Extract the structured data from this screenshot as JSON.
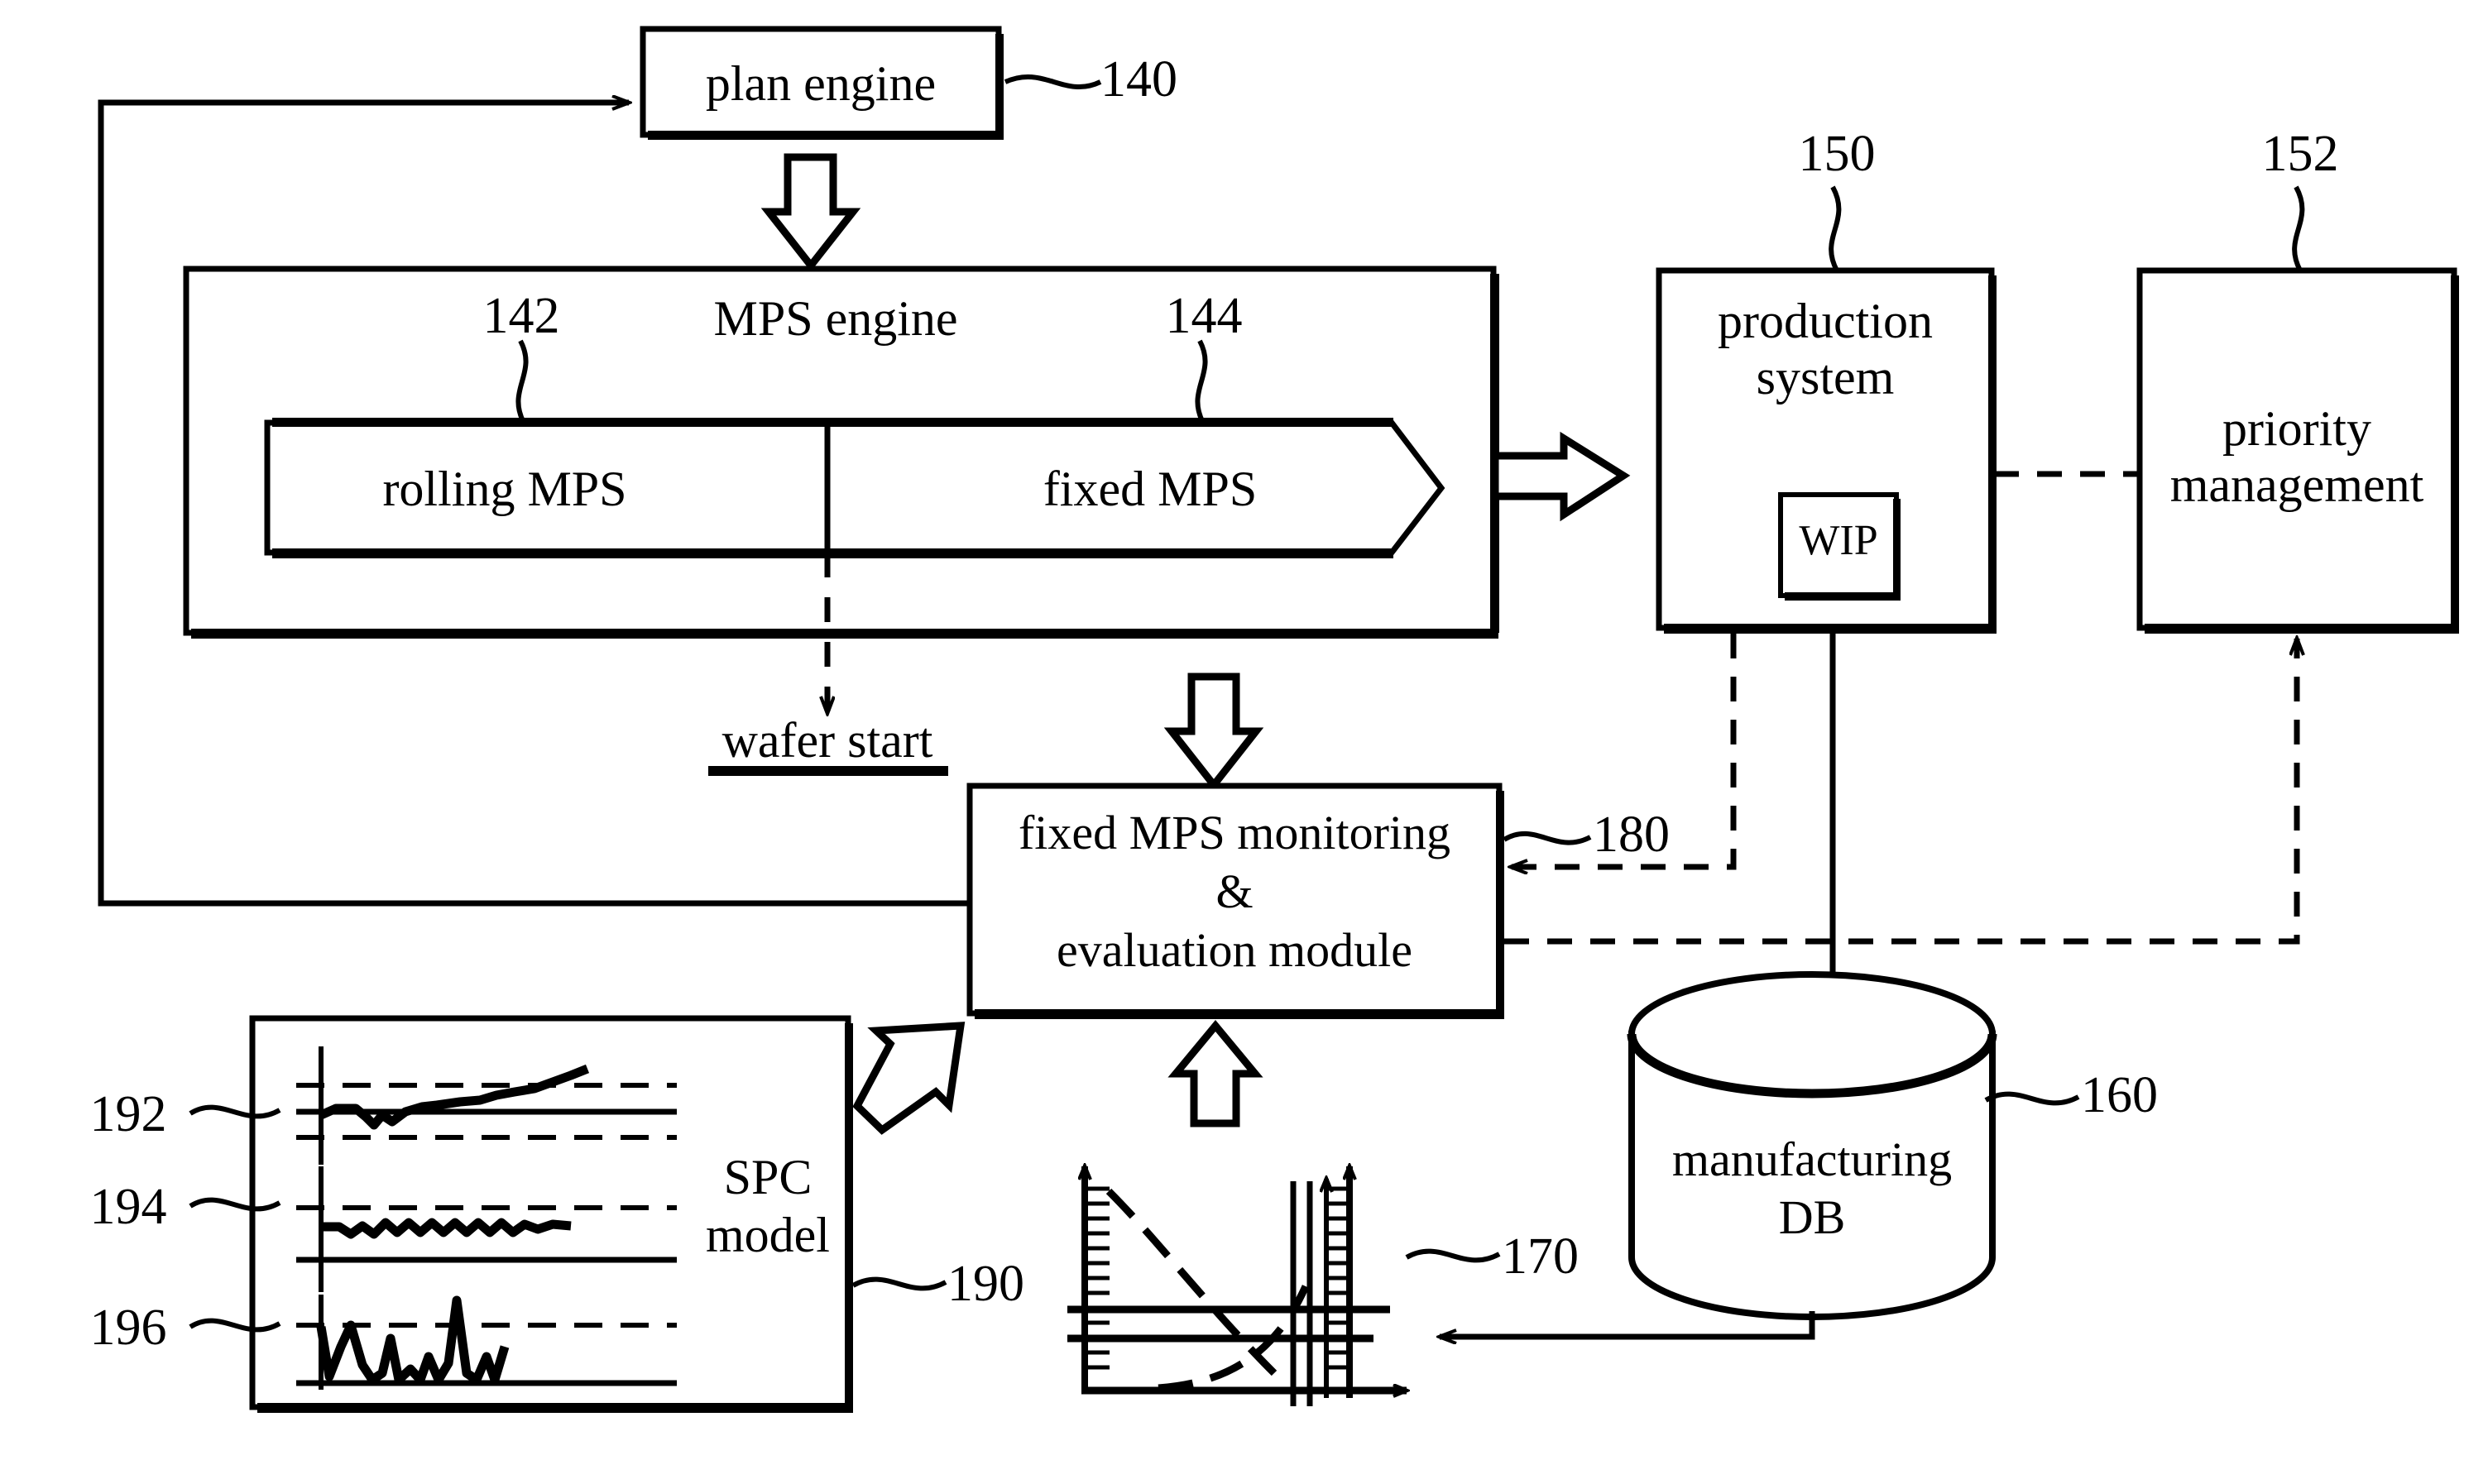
{
  "figure": {
    "type": "patent-block-diagram",
    "title": "Manufacturing planning and MPS monitoring system block diagram"
  },
  "blocks": {
    "plan_engine": {
      "label": "plan engine",
      "ref": "140"
    },
    "mps_engine": {
      "label": "MPS engine",
      "ref": ""
    },
    "rolling_mps": {
      "label": "rolling MPS",
      "ref": "142"
    },
    "fixed_mps": {
      "label": "fixed MPS",
      "ref": "144"
    },
    "production_system": {
      "label_line1": "production",
      "label_line2": "system",
      "ref": "150"
    },
    "wip": {
      "label": "WIP"
    },
    "priority_management": {
      "label_line1": "priority",
      "label_line2": "management",
      "ref": "152"
    },
    "monitoring_module": {
      "label_line1": "fixed MPS monitoring",
      "label_line2": "&",
      "label_line3": "evaluation module",
      "ref": "180"
    },
    "manufacturing_db": {
      "label_line1": "manufacturing",
      "label_line2": "DB",
      "ref": "160"
    },
    "spc_model": {
      "label_line1": "SPC",
      "label_line2": "model",
      "ref": "190"
    },
    "capacity_chart": {
      "ref": "170"
    },
    "wafer_start": {
      "label": "wafer start"
    }
  },
  "spc_charts": [
    {
      "ref": "192",
      "description": "drifting trend exceeding upper control limit"
    },
    {
      "ref": "194",
      "description": "stable oscillating series within limits"
    },
    {
      "ref": "196",
      "description": "spiky series with excursion above limit"
    }
  ],
  "refs": [
    "140",
    "142",
    "144",
    "150",
    "152",
    "160",
    "170",
    "180",
    "190",
    "192",
    "194",
    "196"
  ],
  "colors": {
    "line": "#000000",
    "background": "#ffffff"
  },
  "chart_data": {
    "type": "line",
    "title": "",
    "xlabel": "",
    "ylabel": "",
    "grid": false,
    "legend": "none",
    "series": [
      {
        "name": "decaying curve",
        "style": "dashed",
        "x": [
          0.08,
          0.2,
          0.35,
          0.5,
          0.62,
          0.72,
          0.8
        ],
        "y": [
          0.92,
          0.74,
          0.56,
          0.4,
          0.28,
          0.18,
          0.1
        ]
      },
      {
        "name": "rising curve",
        "style": "dashed",
        "x": [
          0.3,
          0.45,
          0.58,
          0.68,
          0.76,
          0.84
        ],
        "y": [
          0.04,
          0.07,
          0.14,
          0.26,
          0.45,
          0.78
        ]
      },
      {
        "name": "reference line upper",
        "style": "solid-horizontal",
        "y": 0.52
      },
      {
        "name": "reference line lower",
        "style": "solid-horizontal",
        "y": 0.4
      }
    ],
    "axes": {
      "left": "ticked",
      "right": "ticked",
      "bottom": "arrow"
    }
  }
}
